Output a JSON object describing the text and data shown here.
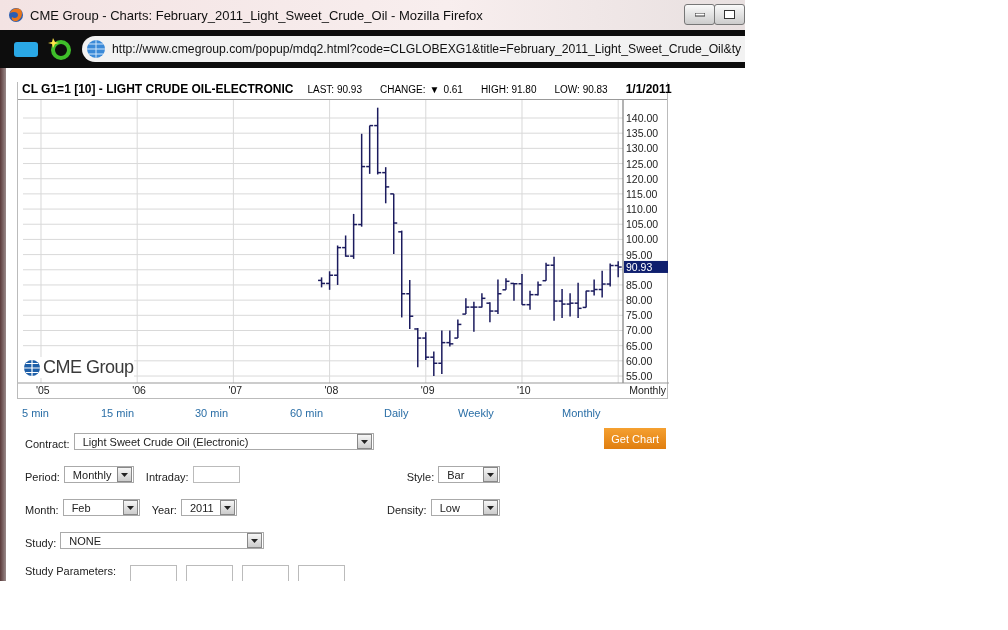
{
  "browser": {
    "title": "CME Group - Charts: February_2011_Light_Sweet_Crude_Oil - Mozilla Firefox",
    "url": "http://www.cmegroup.com/popup/mdq2.html?code=CLGLOBEXG1&title=February_2011_Light_Sweet_Crude_Oil&ty"
  },
  "quote_header": {
    "symbol": "CL G1=1 [10] - LIGHT CRUDE OIL-ELECTRONIC",
    "last": "LAST: 90.93",
    "change_label": "CHANGE:",
    "change_arrow": "▼",
    "change": "0.61",
    "high": "HIGH: 91.80",
    "low": "LOW: 90.83",
    "date": "1/1/2011"
  },
  "chart": {
    "logo": "CME Group",
    "period_label": "Monthly",
    "current_price": "90.93",
    "y_labels": [
      "140.00",
      "135.00",
      "130.00",
      "125.00",
      "120.00",
      "115.00",
      "110.00",
      "105.00",
      "100.00",
      "95.00",
      "85.00",
      "80.00",
      "75.00",
      "70.00",
      "65.00",
      "60.00",
      "55.00"
    ],
    "x_labels": [
      "'05",
      "'06",
      "'07",
      "'08",
      "'09",
      "'10"
    ]
  },
  "interval_links": [
    "5 min",
    "15 min",
    "30 min",
    "60 min",
    "Daily",
    "Weekly",
    "Monthly"
  ],
  "form": {
    "contract": {
      "label": "Contract:",
      "value": "Light Sweet Crude Oil (Electronic)"
    },
    "button": "Get Chart",
    "period": {
      "label": "Period:",
      "value": "Monthly"
    },
    "intraday": {
      "label": "Intraday:"
    },
    "style": {
      "label": "Style:",
      "value": "Bar"
    },
    "month": {
      "label": "Month:",
      "value": "Feb"
    },
    "year": {
      "label": "Year:",
      "value": "2011"
    },
    "density": {
      "label": "Density:",
      "value": "Low"
    },
    "study": {
      "label": "Study:",
      "value": "NONE"
    },
    "study_parameters": {
      "label": "Study Parameters:"
    }
  }
}
